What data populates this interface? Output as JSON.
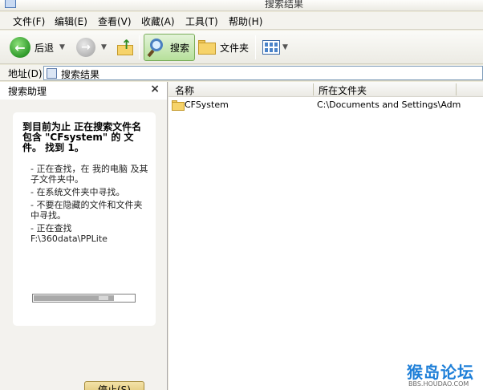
{
  "window": {
    "title": "搜索结果"
  },
  "menu": [
    "文件(F)",
    "编辑(E)",
    "查看(V)",
    "收藏(A)",
    "工具(T)",
    "帮助(H)"
  ],
  "toolbar": {
    "back_label": "后退",
    "search_label": "搜索",
    "folders_label": "文件夹",
    "back_icon": "back-arrow-icon",
    "forward_icon": "forward-arrow-icon",
    "up_icon": "folder-up-icon",
    "search_icon": "magnifier-icon",
    "folders_icon": "folder-icon",
    "views_icon": "views-grid-icon"
  },
  "address": {
    "label": "地址(D)",
    "value": "搜索结果"
  },
  "left_pane": {
    "title": "搜索助理",
    "close": "×",
    "status_heading": "到目前为止 正在搜索文件名包含 \"CFsystem\" 的 文件。 找到 1。",
    "bullets": [
      "- 正在查找，在 我的电脑 及其子文件夹中。",
      "- 在系统文件夹中寻找。",
      "- 不要在隐藏的文件和文件夹中寻找。",
      "- 正在查找 F:\\360data\\PPLite"
    ],
    "progress_fraction": 0.8,
    "stop_label": "停止(S)"
  },
  "results": {
    "columns": [
      "名称",
      "所在文件夹"
    ],
    "rows": [
      {
        "name": "CFSystem",
        "folder": "C:\\Documents and Settings\\Adm..."
      }
    ]
  },
  "watermark": {
    "main": "猴岛论坛",
    "sub": "BBS.HOUDAO.COM"
  }
}
